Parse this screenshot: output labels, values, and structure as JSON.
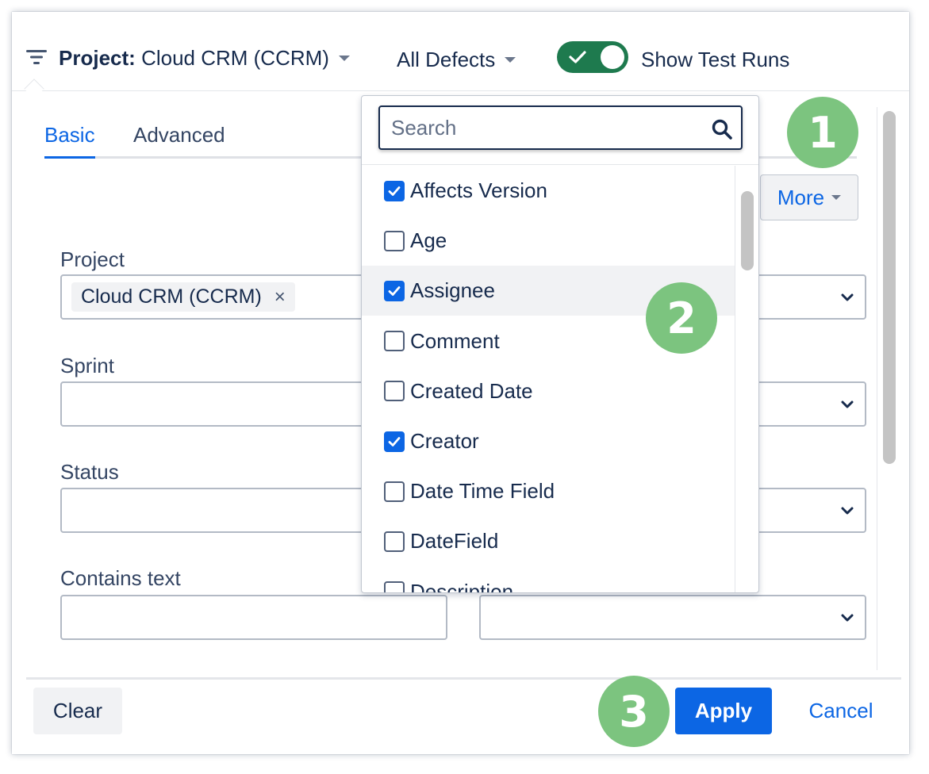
{
  "header": {
    "project_label": "Project",
    "project_colon": ":",
    "project_value": "Cloud CRM (CCRM)",
    "defects_label": "All Defects",
    "toggle_on": true,
    "toggle_label": "Show Test Runs"
  },
  "tabs": [
    {
      "label": "Basic",
      "active": true
    },
    {
      "label": "Advanced",
      "active": false
    }
  ],
  "more_button": "More",
  "fields": {
    "project": {
      "label": "Project",
      "chip": "Cloud CRM (CCRM)",
      "chip_remove": "×"
    },
    "sprint": {
      "label": "Sprint"
    },
    "status": {
      "label": "Status"
    },
    "contains_text": {
      "label": "Contains text",
      "value": ""
    }
  },
  "dropdown": {
    "search_placeholder": "Search",
    "items": [
      {
        "label": "Affects Version",
        "checked": true
      },
      {
        "label": "Age",
        "checked": false
      },
      {
        "label": "Assignee",
        "checked": true,
        "hovered": true
      },
      {
        "label": "Comment",
        "checked": false
      },
      {
        "label": "Created Date",
        "checked": false
      },
      {
        "label": "Creator",
        "checked": true
      },
      {
        "label": "Date Time Field",
        "checked": false
      },
      {
        "label": "DateField",
        "checked": false
      },
      {
        "label": "Description",
        "checked": false
      }
    ]
  },
  "footer": {
    "clear": "Clear",
    "apply": "Apply",
    "cancel": "Cancel"
  },
  "badges": [
    "1",
    "2",
    "3"
  ],
  "colors": {
    "accent": "#0c66e4",
    "toggle": "#1e7a4e",
    "badge": "#7cc47f",
    "text": "#172b4d"
  },
  "icons": [
    "filter-icon",
    "chevron-down-icon",
    "check-icon",
    "search-icon",
    "close-icon"
  ]
}
